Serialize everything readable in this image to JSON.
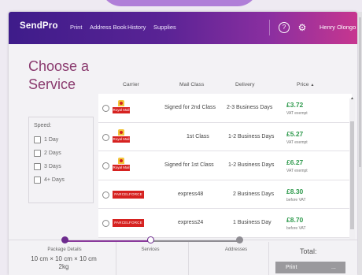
{
  "header": {
    "brand": "SendPro",
    "nav": [
      "Print",
      "Address Book",
      "History",
      "Supplies"
    ],
    "user": "Henry Olongo",
    "help_icon": "help-circle-icon",
    "settings_icon": "gear-icon"
  },
  "page_title": "Choose a Service",
  "speed_filter": {
    "title": "Speed:",
    "options": [
      "1 Day",
      "2 Days",
      "3 Days",
      "4+ Days"
    ]
  },
  "table": {
    "columns": {
      "carrier": "Carrier",
      "mail_class": "Mail Class",
      "delivery": "Delivery",
      "price": "Price",
      "sort_icon": "▲"
    },
    "rows": [
      {
        "carrier": "Royal Mail",
        "mail_class": "Signed for 2nd Class",
        "delivery": "2-3 Business Days",
        "price": "£3.72",
        "vat": "VAT exempt"
      },
      {
        "carrier": "Royal Mail",
        "mail_class": "1st Class",
        "delivery": "1-2 Business Days",
        "price": "£5.27",
        "vat": "VAT exempt"
      },
      {
        "carrier": "Royal Mail",
        "mail_class": "Signed for 1st Class",
        "delivery": "1-2 Business Days",
        "price": "£6.27",
        "vat": "VAT exempt"
      },
      {
        "carrier": "PARCELFORCE",
        "mail_class": "express48",
        "delivery": "2 Business Days",
        "price": "£8.30",
        "vat": "before VAT"
      },
      {
        "carrier": "PARCELFORCE",
        "mail_class": "express24",
        "delivery": "1 Business Day",
        "price": "£8.70",
        "vat": "before VAT"
      }
    ]
  },
  "progress": {
    "steps": [
      "Package Details",
      "Services",
      "Addresses"
    ],
    "package_dims": "10 cm × 10 cm × 10 cm",
    "package_weight": "2kg"
  },
  "total": {
    "label": "Total:",
    "print_label": "Print",
    "print_ellipsis": "..."
  },
  "colors": {
    "header_start": "#3e1c8a",
    "header_end": "#c7368f",
    "title": "#8a3a6e",
    "price": "#2f9a4d",
    "royal_mail_red": "#d62220"
  }
}
